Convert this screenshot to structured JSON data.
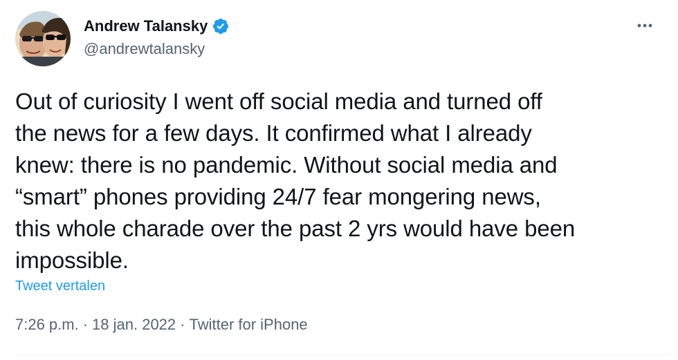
{
  "author": {
    "name": "Andrew Talansky",
    "handle": "@andrewtalansky",
    "verified": true,
    "verified_icon": "verified-badge-icon",
    "avatar_icon": "profile-photo"
  },
  "tweet": {
    "text": "Out of curiosity I went off social media and turned off\nthe news for a few days. It confirmed what I already\nknew: there is no pandemic. Without social media and\n“smart” phones providing 24/7 fear mongering news,\nthis whole charade over the past 2 yrs would have been\nimpossible.",
    "translate_label": "Tweet vertalen"
  },
  "meta": {
    "time": "7:26 p.m.",
    "separator": "·",
    "date": "18 jan. 2022",
    "source": "Twitter for iPhone"
  },
  "actions": {
    "more_icon": "more-dots-icon"
  },
  "colors": {
    "text_primary": "#0f1419",
    "text_secondary": "#536471",
    "link": "#1d9bf0",
    "verified": "#1d9bf0",
    "divider": "#eff3f4"
  }
}
